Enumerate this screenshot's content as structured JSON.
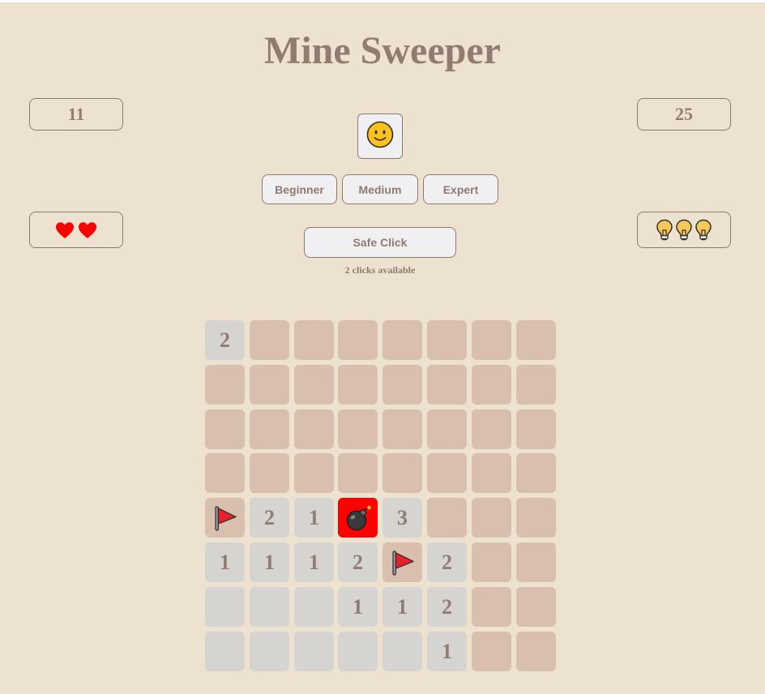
{
  "title": "Mine Sweeper",
  "mines_counter": "11",
  "timer": "25",
  "lives": {
    "count": 2,
    "icon": "heart-icon",
    "color": "#ff0000"
  },
  "hints": {
    "count": 3,
    "icon": "lightbulb-icon",
    "color": "#f7c75c"
  },
  "smiley": {
    "icon": "smiley-face-icon",
    "state": "normal"
  },
  "difficulty": {
    "beginner_label": "Beginner",
    "medium_label": "Medium",
    "expert_label": "Expert"
  },
  "safe_click": {
    "label": "Safe Click",
    "note": "2 clicks available"
  },
  "board": {
    "rows": 8,
    "cols": 8,
    "legend": {
      "H": "hidden",
      "F": "flag",
      "M": "exploded-mine",
      "0": "empty",
      "1-8": "number"
    },
    "cells": [
      [
        "2",
        "H",
        "H",
        "H",
        "H",
        "H",
        "H",
        "H"
      ],
      [
        "H",
        "H",
        "H",
        "H",
        "H",
        "H",
        "H",
        "H"
      ],
      [
        "H",
        "H",
        "H",
        "H",
        "H",
        "H",
        "H",
        "H"
      ],
      [
        "H",
        "H",
        "H",
        "H",
        "H",
        "H",
        "H",
        "H"
      ],
      [
        "F",
        "2",
        "1",
        "M",
        "3",
        "H",
        "H",
        "H"
      ],
      [
        "1",
        "1",
        "1",
        "2",
        "F",
        "2",
        "H",
        "H"
      ],
      [
        "0",
        "0",
        "0",
        "1",
        "1",
        "2",
        "H",
        "H"
      ],
      [
        "0",
        "0",
        "0",
        "0",
        "0",
        "1",
        "H",
        "H"
      ]
    ]
  },
  "colors": {
    "background": "#ede2cf",
    "text": "#927b71",
    "hidden_cell": "#d9c0ae",
    "revealed_cell": "#d5d4d0",
    "exploded_cell": "#ff0000",
    "flag": "#e8202a"
  }
}
